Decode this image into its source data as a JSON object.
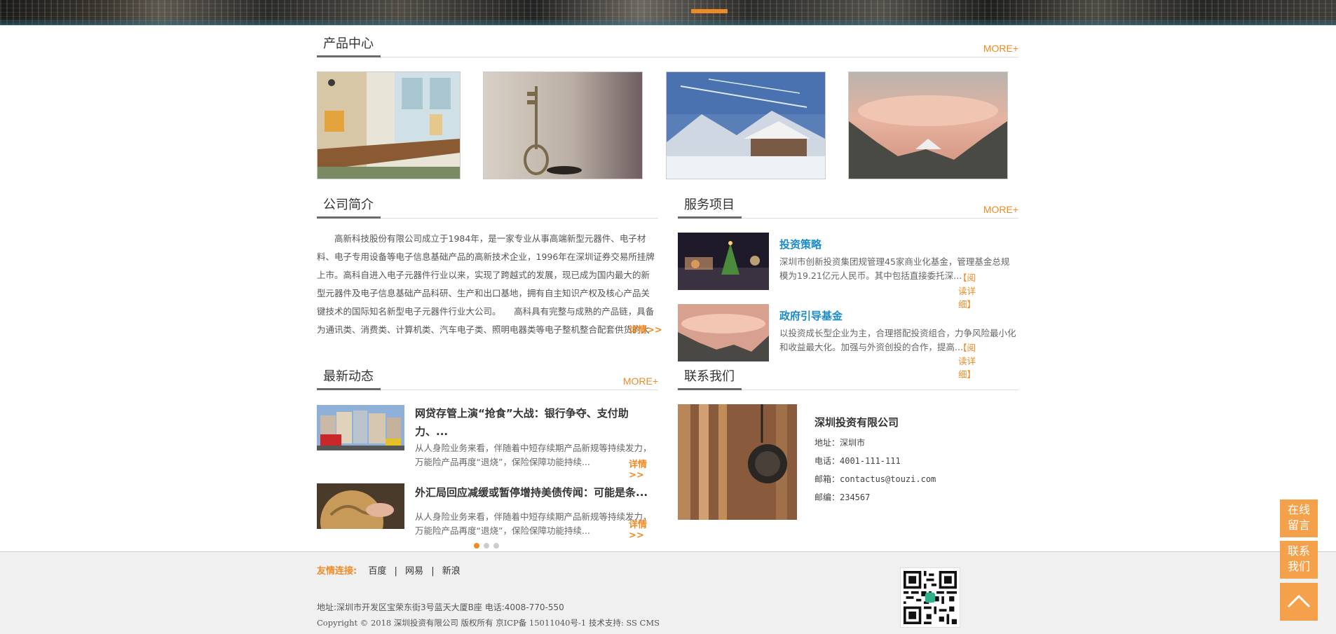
{
  "product": {
    "title": "产品中心",
    "more": "MORE+"
  },
  "about": {
    "title": "公司简介",
    "text": "高新科技股份有限公司成立于1984年，是一家专业从事高端新型元器件、电子材料、电子专用设备等电子信息基础产品的高新技术企业，1996年在深圳证券交易所挂牌上市。高科自进入电子元器件行业以来，实现了跨越式的发展，现已成为国内最大的新型元器件及电子信息基础产品科研、生产和出口基地，拥有自主知识产权及核心产品关键技术的国际知名新型电子元器件行业大公司。　　高科具有完整与成熟的产品链，具备为通讯类、消费类、计算机类、汽车电子类、照明电器类等电子整机整合配套供货的大规...",
    "detail": "详情>>"
  },
  "services": {
    "title": "服务项目",
    "more": "MORE+",
    "items": [
      {
        "title": "投资策略",
        "desc": "深圳市创新投资集团规管理45家商业化基金，管理基金总规模为19.21亿元人民币。其中包括直接委托深...",
        "link": "【阅读详细】"
      },
      {
        "title": "政府引导基金",
        "desc": "以投资成长型企业为主，合理搭配投资组合，力争风险最小化和收益最大化。加强与外资创投的合作，提高...",
        "link": "【阅读详细】"
      }
    ]
  },
  "news": {
    "title": "最新动态",
    "more": "MORE+",
    "items": [
      {
        "title": "网贷存管上演“抢食”大战：银行争夺、支付助力、...",
        "desc": "从人身险业务来看，伴随着中短存续期产品新规等持续发力，万能险产品再度“退烧”，保险保障功能持续...",
        "link": "详情>>"
      },
      {
        "title": "外汇局回应减缓或暂停增持美债传闻：可能是条...",
        "desc": "从人身险业务来看，伴随着中短存续期产品新规等持续发力，万能险产品再度“退烧”，保险保障功能持续...",
        "link": "详情>>"
      }
    ]
  },
  "contact": {
    "title": "联系我们",
    "company": "深圳投资有限公司",
    "addr": "地址：深圳市",
    "phone": "电话：4001-111-111",
    "email": "邮箱：contactus@touzi.com",
    "zip": "邮编：234567"
  },
  "footer": {
    "links_label": "友情连接:",
    "links": [
      "百度",
      "网易",
      "新浪"
    ],
    "address": "地址:深圳市开发区宝荣东街3号蓝天大厦B座 电话:4008-770-550",
    "copyright": "Copyright © 2018 深圳投资有限公司 版权所有 京ICP备 15011040号-1 技术支持: SS CMS"
  },
  "side": {
    "message": "在线留言",
    "contact": "联系我们"
  },
  "colors": {
    "accent": "#f08a24",
    "link_blue": "#1a8bc8",
    "side_button": "#f5a04a"
  }
}
